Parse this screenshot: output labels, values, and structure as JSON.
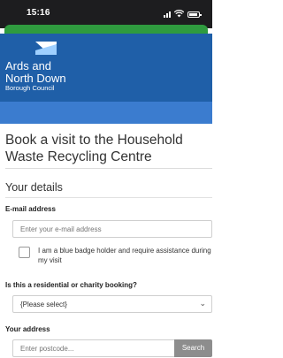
{
  "status_bar": {
    "time": "15:16"
  },
  "header": {
    "council_name_line1": "Ards and",
    "council_name_line2": "North Down",
    "council_subtitle": "Borough Council",
    "colors": {
      "header_bg": "#1f5fa8",
      "nav_band": "#3b7ccf",
      "url_pill": "#2f9b3f"
    }
  },
  "page": {
    "title": "Book a visit to the Household Waste Recycling Centre",
    "section_title": "Your details"
  },
  "form": {
    "email_label": "E-mail address",
    "email_placeholder": "Enter your e-mail address",
    "blue_badge_label": "I am a blue badge holder and require assistance during my visit",
    "blue_badge_checked": false,
    "booking_type_label": "Is this a residential or charity booking?",
    "booking_type_selected": "{Please select}",
    "address_label": "Your address",
    "postcode_placeholder": "Enter postcode...",
    "search_label": "Search"
  }
}
